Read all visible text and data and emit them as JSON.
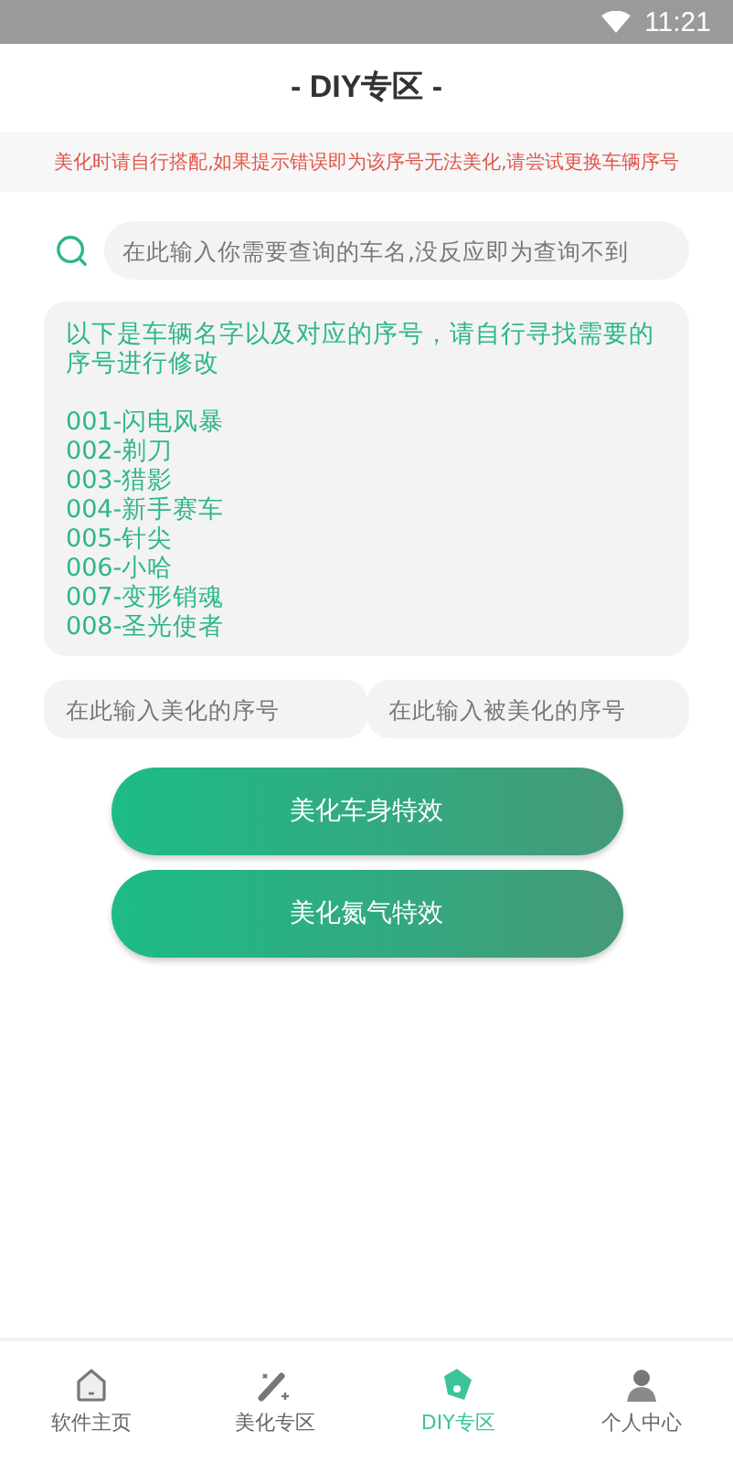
{
  "status_bar": {
    "time": "11:21"
  },
  "title": "- DIY专区 -",
  "notice": "美化时请自行搭配,如果提示错误即为该序号无法美化,请尝试更换车辆序号",
  "search": {
    "placeholder": "在此输入你需要查询的车名,没反应即为查询不到"
  },
  "info": {
    "intro": "以下是车辆名字以及对应的序号，请自行寻找需要的序号进行修改",
    "entries": [
      "001-闪电风暴",
      "002-剃刀",
      "003-猎影",
      "004-新手赛车",
      "005-针尖",
      "006-小哈",
      "007-变形销魂",
      "008-圣光使者"
    ]
  },
  "inputs": [
    {
      "placeholder": "在此输入美化的序号"
    },
    {
      "placeholder": "在此输入被美化的序号"
    }
  ],
  "buttons": [
    "美化车身特效",
    "美化氮气特效"
  ],
  "nav": [
    {
      "label": "软件主页",
      "selected": false
    },
    {
      "label": "美化专区",
      "selected": false
    },
    {
      "label": "DIY专区",
      "selected": true
    },
    {
      "label": "个人中心",
      "selected": false
    }
  ]
}
